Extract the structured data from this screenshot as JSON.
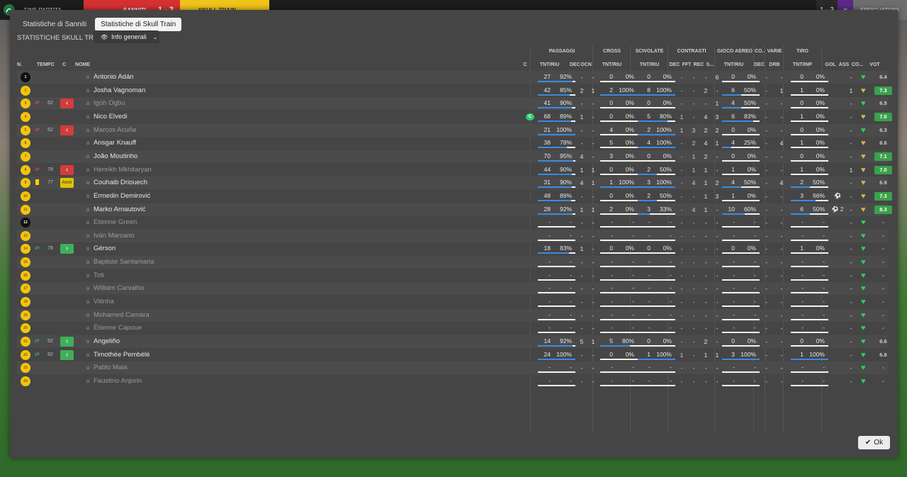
{
  "topbar": {
    "left_label": "FINE PARTITA",
    "home": "SANNITI",
    "score": "1 - 3",
    "away": "SKULL TRAIN",
    "right_score": "1 - 3",
    "right_label": "SPOGLIATOIO"
  },
  "tabs": [
    {
      "label": "Statistiche di Sanniti",
      "active": false
    },
    {
      "label": "Statistiche di Skull Train",
      "active": true
    }
  ],
  "section_title": "STATISTICHE SKULL TRAIN",
  "view_dropdown": {
    "label": "Info generali"
  },
  "group_headers": [
    "PASSAGGI",
    "CROSS",
    "SCIVOLATE",
    "CONTRASTI",
    "GIOCO AEREO",
    "CO...",
    "VARIE",
    "TIRO"
  ],
  "columns": [
    "N.",
    "TEMPO",
    "C",
    "NOME",
    "C",
    "TNT/RIU",
    "DEC",
    "OCN",
    "TNT/RIU",
    "TNT/RIU",
    "DEC",
    "FFT",
    "REC",
    "S...",
    "TNT/RIU",
    "DEC",
    "DRB",
    "TNT/INP",
    "GOL",
    "ASS",
    "CO...",
    "VOT"
  ],
  "players": [
    {
      "num": "1",
      "shirt": "gk",
      "name": "Antonio Adán",
      "dim": false,
      "sub": "",
      "min": "",
      "tag": "",
      "pas": [
        "27",
        "92%"
      ],
      "pas_pct": 92,
      "dec": "-",
      "ocn": "-",
      "cross": [
        "0",
        "0%"
      ],
      "cross_pct": 0,
      "sciv": [
        "0",
        "0%"
      ],
      "sciv_pct": 0,
      "cdec": "-",
      "fft": "-",
      "rec": "-",
      "s": "6",
      "aer": [
        "0",
        "0%"
      ],
      "aer_pct": 0,
      "vdec": "-",
      "drb": "-",
      "tiro": [
        "0",
        "0%"
      ],
      "tiro_pct": 0,
      "gol": "",
      "ass": "-",
      "heart": "green",
      "vot": "6.4",
      "vot_hi": false
    },
    {
      "num": "2",
      "shirt": "out",
      "name": "Josha Vagnoman",
      "dim": false,
      "sub": "",
      "min": "",
      "tag": "",
      "pas": [
        "42",
        "85%"
      ],
      "pas_pct": 85,
      "dec": "2",
      "ocn": "1",
      "cross": [
        "2",
        "100%"
      ],
      "cross_pct": 100,
      "sciv": [
        "8",
        "100%"
      ],
      "sciv_pct": 100,
      "cdec": "-",
      "fft": "-",
      "rec": "2",
      "s": "-",
      "aer": [
        "6",
        "50%"
      ],
      "aer_pct": 50,
      "vdec": "-",
      "drb": "1",
      "tiro": [
        "1",
        "0%"
      ],
      "tiro_pct": 0,
      "gol": "",
      "ass": "1",
      "heart": "gold",
      "vot": "7.3",
      "vot_hi": true
    },
    {
      "num": "3",
      "shirt": "out",
      "name": "Igoh Ogbu",
      "dim": true,
      "sub": "out",
      "min": "62",
      "tag": "red",
      "pas": [
        "41",
        "90%"
      ],
      "pas_pct": 90,
      "dec": "-",
      "ocn": "-",
      "cross": [
        "0",
        "0%"
      ],
      "cross_pct": 0,
      "sciv": [
        "0",
        "0%"
      ],
      "sciv_pct": 0,
      "cdec": "-",
      "fft": "-",
      "rec": "-",
      "s": "1",
      "aer": [
        "4",
        "50%"
      ],
      "aer_pct": 50,
      "vdec": "-",
      "drb": "-",
      "tiro": [
        "0",
        "0%"
      ],
      "tiro_pct": 0,
      "gol": "",
      "ass": "-",
      "heart": "green",
      "vot": "6.5",
      "vot_hi": false
    },
    {
      "num": "4",
      "shirt": "out",
      "name": "Nico Elvedi",
      "dim": false,
      "sub": "",
      "min": "",
      "tag": "",
      "captain": true,
      "pas": [
        "68",
        "89%"
      ],
      "pas_pct": 89,
      "dec": "1",
      "ocn": "-",
      "cross": [
        "0",
        "0%"
      ],
      "cross_pct": 0,
      "sciv": [
        "5",
        "80%"
      ],
      "sciv_pct": 80,
      "cdec": "1",
      "fft": "-",
      "rec": "4",
      "s": "3",
      "aer": [
        "6",
        "83%"
      ],
      "aer_pct": 83,
      "vdec": "-",
      "drb": "-",
      "tiro": [
        "1",
        "0%"
      ],
      "tiro_pct": 0,
      "gol": "",
      "ass": "-",
      "heart": "gold",
      "vot": "7.0",
      "vot_hi": true
    },
    {
      "num": "5",
      "shirt": "out",
      "name": "Marcos Acuña",
      "dim": true,
      "sub": "out",
      "min": "62",
      "tag": "red",
      "pas": [
        "21",
        "100%"
      ],
      "pas_pct": 100,
      "dec": "-",
      "ocn": "-",
      "cross": [
        "4",
        "0%"
      ],
      "cross_pct": 0,
      "sciv": [
        "2",
        "100%"
      ],
      "sciv_pct": 100,
      "cdec": "1",
      "fft": "3",
      "rec": "2",
      "s": "2",
      "aer": [
        "0",
        "0%"
      ],
      "aer_pct": 0,
      "vdec": "-",
      "drb": "-",
      "tiro": [
        "0",
        "0%"
      ],
      "tiro_pct": 0,
      "gol": "",
      "ass": "-",
      "heart": "green",
      "vot": "6.3",
      "vot_hi": false
    },
    {
      "num": "6",
      "shirt": "out",
      "name": "Ansgar Knauff",
      "dim": false,
      "sub": "",
      "min": "",
      "tag": "",
      "pas": [
        "38",
        "78%"
      ],
      "pas_pct": 78,
      "dec": "-",
      "ocn": "-",
      "cross": [
        "5",
        "0%"
      ],
      "cross_pct": 0,
      "sciv": [
        "4",
        "100%"
      ],
      "sciv_pct": 100,
      "cdec": "-",
      "fft": "2",
      "rec": "4",
      "s": "1",
      "aer": [
        "4",
        "25%"
      ],
      "aer_pct": 25,
      "vdec": "-",
      "drb": "4",
      "tiro": [
        "1",
        "0%"
      ],
      "tiro_pct": 0,
      "gol": "",
      "ass": "-",
      "heart": "gold",
      "vot": "6.6",
      "vot_hi": false
    },
    {
      "num": "7",
      "shirt": "out",
      "name": "João Moutinho",
      "dim": false,
      "sub": "",
      "min": "",
      "tag": "",
      "pas": [
        "70",
        "95%"
      ],
      "pas_pct": 95,
      "dec": "4",
      "ocn": "-",
      "cross": [
        "3",
        "0%"
      ],
      "cross_pct": 0,
      "sciv": [
        "0",
        "0%"
      ],
      "sciv_pct": 0,
      "cdec": "-",
      "fft": "1",
      "rec": "2",
      "s": "-",
      "aer": [
        "0",
        "0%"
      ],
      "aer_pct": 0,
      "vdec": "-",
      "drb": "-",
      "tiro": [
        "0",
        "0%"
      ],
      "tiro_pct": 0,
      "gol": "",
      "ass": "-",
      "heart": "gold",
      "vot": "7.1",
      "vot_hi": true
    },
    {
      "num": "8",
      "shirt": "out",
      "name": "Henrikh Mkhitaryan",
      "dim": true,
      "sub": "out",
      "min": "78",
      "tag": "red",
      "pas": [
        "44",
        "90%"
      ],
      "pas_pct": 90,
      "dec": "1",
      "ocn": "1",
      "cross": [
        "0",
        "0%"
      ],
      "cross_pct": 0,
      "sciv": [
        "2",
        "50%"
      ],
      "sciv_pct": 50,
      "cdec": "-",
      "fft": "1",
      "rec": "1",
      "s": "-",
      "aer": [
        "1",
        "0%"
      ],
      "aer_pct": 0,
      "vdec": "-",
      "drb": "-",
      "tiro": [
        "1",
        "0%"
      ],
      "tiro_pct": 0,
      "gol": "",
      "ass": "1",
      "heart": "gold",
      "vot": "7.0",
      "vot_hi": true
    },
    {
      "num": "9",
      "shirt": "out",
      "name": "Couhaib Driouech",
      "dim": false,
      "sub": "yellow",
      "min": "77",
      "tag": "Amm",
      "pas": [
        "31",
        "90%"
      ],
      "pas_pct": 90,
      "dec": "4",
      "ocn": "1",
      "cross": [
        "1",
        "100%"
      ],
      "cross_pct": 100,
      "sciv": [
        "3",
        "100%"
      ],
      "sciv_pct": 100,
      "cdec": "-",
      "fft": "4",
      "rec": "1",
      "s": "2",
      "aer": [
        "4",
        "50%"
      ],
      "aer_pct": 50,
      "vdec": "-",
      "drb": "4",
      "tiro": [
        "2",
        "50%"
      ],
      "tiro_pct": 50,
      "gol": "",
      "ass": "-",
      "heart": "gold",
      "vot": "6.9",
      "vot_hi": false
    },
    {
      "num": "10",
      "shirt": "out",
      "name": "Ermedin Demirović",
      "dim": false,
      "sub": "",
      "min": "",
      "tag": "",
      "pas": [
        "48",
        "89%"
      ],
      "pas_pct": 89,
      "dec": "-",
      "ocn": "-",
      "cross": [
        "0",
        "0%"
      ],
      "cross_pct": 0,
      "sciv": [
        "2",
        "50%"
      ],
      "sciv_pct": 50,
      "cdec": "-",
      "fft": "-",
      "rec": "1",
      "s": "3",
      "aer": [
        "1",
        "0%"
      ],
      "aer_pct": 0,
      "vdec": "-",
      "drb": "-",
      "tiro": [
        "3",
        "66%"
      ],
      "tiro_pct": 66,
      "gol": "⚽",
      "ass": "-",
      "heart": "gold",
      "vot": "7.3",
      "vot_hi": true
    },
    {
      "num": "11",
      "shirt": "out",
      "name": "Marko Arnautović",
      "dim": false,
      "sub": "",
      "min": "",
      "tag": "",
      "pas": [
        "28",
        "92%"
      ],
      "pas_pct": 92,
      "dec": "1",
      "ocn": "1",
      "cross": [
        "2",
        "0%"
      ],
      "cross_pct": 0,
      "sciv": [
        "3",
        "33%"
      ],
      "sciv_pct": 33,
      "cdec": "-",
      "fft": "4",
      "rec": "1",
      "s": "-",
      "aer": [
        "10",
        "60%"
      ],
      "aer_pct": 60,
      "vdec": "-",
      "drb": "-",
      "tiro": [
        "6",
        "50%"
      ],
      "tiro_pct": 50,
      "gol": "⚽ 2",
      "ass": "-",
      "heart": "gold",
      "vot": "8.3",
      "vot_hi": true
    },
    {
      "num": "12",
      "shirt": "gk",
      "name": "Etienne Green",
      "dim": true,
      "sub": "",
      "min": "",
      "tag": "",
      "empty": true,
      "heart": "green",
      "vot": "-"
    },
    {
      "num": "13",
      "shirt": "out",
      "name": "Iván Marcano",
      "dim": true,
      "sub": "",
      "min": "",
      "tag": "",
      "empty": true,
      "heart": "green",
      "vot": "-"
    },
    {
      "num": "14",
      "shirt": "out",
      "name": "Gérson",
      "dim": false,
      "sub": "in",
      "min": "78",
      "tag": "green",
      "pas": [
        "18",
        "83%"
      ],
      "pas_pct": 83,
      "dec": "1",
      "ocn": "-",
      "cross": [
        "0",
        "0%"
      ],
      "cross_pct": 0,
      "sciv": [
        "0",
        "0%"
      ],
      "sciv_pct": 0,
      "cdec": "-",
      "fft": "-",
      "rec": "-",
      "s": "-",
      "aer": [
        "0",
        "0%"
      ],
      "aer_pct": 0,
      "vdec": "-",
      "drb": "-",
      "tiro": [
        "1",
        "0%"
      ],
      "tiro_pct": 0,
      "gol": "",
      "ass": "-",
      "heart": "green",
      "vot": "-",
      "vot_hi": false
    },
    {
      "num": "15",
      "shirt": "out",
      "name": "Baptiste Santamaria",
      "dim": true,
      "sub": "",
      "min": "",
      "tag": "",
      "empty": true,
      "heart": "green",
      "vot": "-"
    },
    {
      "num": "16",
      "shirt": "out",
      "name": "Toti",
      "dim": true,
      "sub": "",
      "min": "",
      "tag": "",
      "empty": true,
      "heart": "green",
      "vot": "-"
    },
    {
      "num": "17",
      "shirt": "out",
      "name": "William Carvalho",
      "dim": true,
      "sub": "",
      "min": "",
      "tag": "",
      "empty": true,
      "heart": "green",
      "vot": "-"
    },
    {
      "num": "18",
      "shirt": "out",
      "name": "Vitinha",
      "dim": true,
      "sub": "",
      "min": "",
      "tag": "",
      "empty": true,
      "heart": "green",
      "vot": "-"
    },
    {
      "num": "19",
      "shirt": "out",
      "name": "Mohamed Camara",
      "dim": true,
      "sub": "",
      "min": "",
      "tag": "",
      "empty": true,
      "heart": "green",
      "vot": "-"
    },
    {
      "num": "20",
      "shirt": "out",
      "name": "Étienne Capoue",
      "dim": true,
      "sub": "",
      "min": "",
      "tag": "",
      "empty": true,
      "heart": "green",
      "vot": "-"
    },
    {
      "num": "21",
      "shirt": "out",
      "name": "Angeliño",
      "dim": false,
      "sub": "in",
      "min": "62",
      "tag": "green",
      "pas": [
        "14",
        "92%"
      ],
      "pas_pct": 92,
      "dec": "5",
      "ocn": "1",
      "cross": [
        "5",
        "80%"
      ],
      "cross_pct": 80,
      "sciv": [
        "0",
        "0%"
      ],
      "sciv_pct": 0,
      "cdec": "-",
      "fft": "-",
      "rec": "2",
      "s": "-",
      "aer": [
        "0",
        "0%"
      ],
      "aer_pct": 0,
      "vdec": "-",
      "drb": "-",
      "tiro": [
        "0",
        "0%"
      ],
      "tiro_pct": 0,
      "gol": "",
      "ass": "-",
      "heart": "green",
      "vot": "6.6",
      "vot_hi": false
    },
    {
      "num": "22",
      "shirt": "out",
      "name": "Timothée Pembélé",
      "dim": false,
      "sub": "in",
      "min": "62",
      "tag": "green",
      "pas": [
        "24",
        "100%"
      ],
      "pas_pct": 100,
      "dec": "-",
      "ocn": "-",
      "cross": [
        "0",
        "0%"
      ],
      "cross_pct": 0,
      "sciv": [
        "1",
        "100%"
      ],
      "sciv_pct": 100,
      "cdec": "1",
      "fft": "-",
      "rec": "1",
      "s": "1",
      "aer": [
        "3",
        "100%"
      ],
      "aer_pct": 100,
      "vdec": "-",
      "drb": "-",
      "tiro": [
        "1",
        "100%"
      ],
      "tiro_pct": 100,
      "gol": "",
      "ass": "-",
      "heart": "green",
      "vot": "6.8",
      "vot_hi": false
    },
    {
      "num": "23",
      "shirt": "out",
      "name": "Pablo Maia",
      "dim": true,
      "sub": "",
      "min": "",
      "tag": "",
      "empty": true,
      "heart": "green",
      "vot": "-"
    },
    {
      "num": "24",
      "shirt": "out",
      "name": "Faustino Anjorin",
      "dim": true,
      "sub": "",
      "min": "",
      "tag": "",
      "empty": true,
      "heart": "green",
      "vot": "-"
    }
  ],
  "ok_button": {
    "label": "Ok"
  }
}
